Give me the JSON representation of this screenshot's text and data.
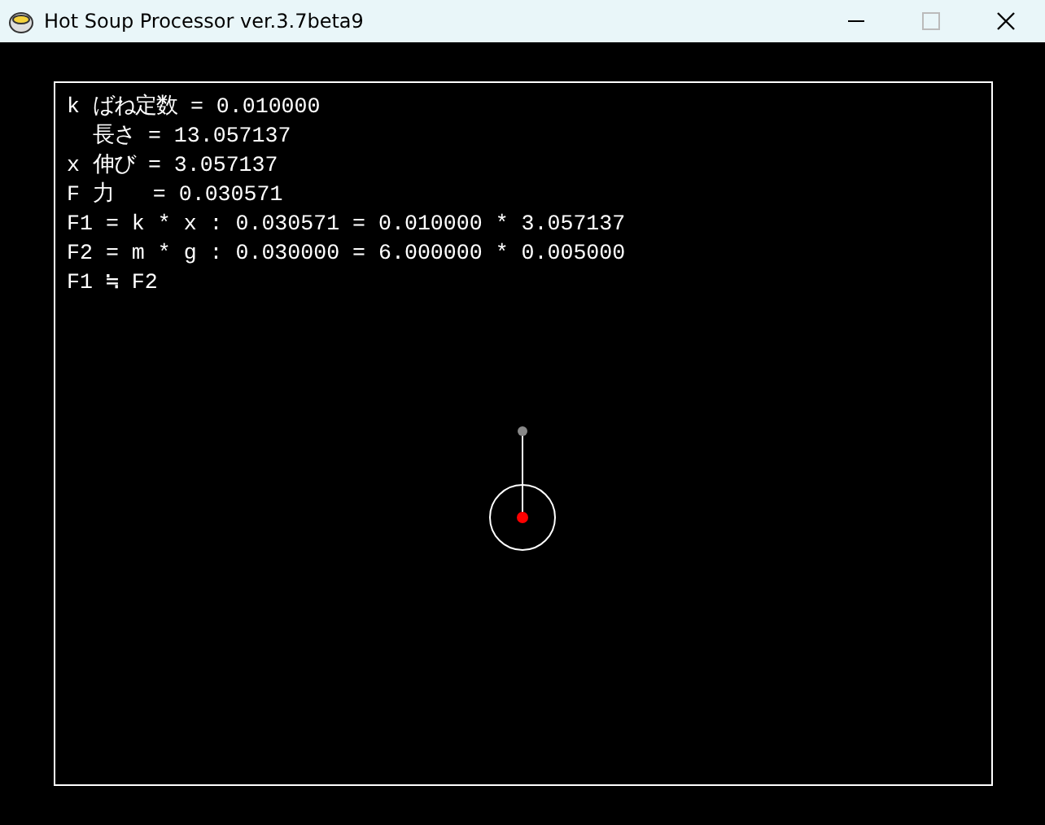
{
  "window": {
    "title": "Hot Soup Processor ver.3.7beta9"
  },
  "lines": [
    "k ばね定数 = 0.010000",
    "  長さ = 13.057137",
    "x 伸び = 3.057137",
    "F 力   = 0.030571",
    "F1 = k * x : 0.030571 = 0.010000 * 3.057137",
    "F2 = m * g : 0.030000 = 6.000000 * 0.005000",
    "F1 ≒ F2"
  ]
}
